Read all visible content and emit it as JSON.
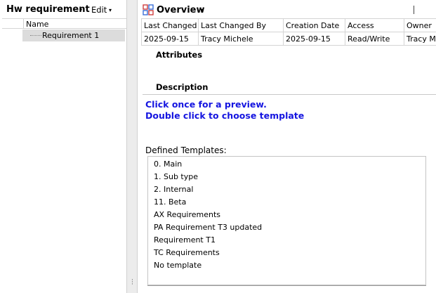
{
  "left_panel": {
    "title": "Hw requirement",
    "title_caret": "▾",
    "edit_label": "Edit",
    "edit_caret": "▾",
    "tree_column": "Name",
    "tree_items": [
      "Requirement 1"
    ]
  },
  "overview": {
    "title": "Overview",
    "caret": "▾",
    "icon": "overview-grid-icon",
    "icon_colors": [
      "#d04040",
      "#3a6fd8",
      "#d04040",
      "#3a6fd8"
    ]
  },
  "properties": {
    "headers": [
      "Last Changed",
      "Last Changed By",
      "Creation Date",
      "Access",
      "Owner"
    ],
    "row": [
      "2025-09-15",
      "Tracy Michele",
      "2025-09-15",
      "Read/Write",
      "Tracy Mic"
    ]
  },
  "sections": {
    "attributes": "Attributes",
    "description": "Description"
  },
  "preview": {
    "line1": "Click once for a preview.",
    "line2": "Double click to choose template",
    "color": "#1515e0"
  },
  "templates": {
    "label": "Defined Templates:",
    "items": [
      "0. Main",
      "1. Sub type",
      "2. Internal",
      "11. Beta",
      "AX Requirements",
      "PA Requirement T3 updated",
      "Requirement T1",
      "TC Requirements",
      "No template"
    ]
  }
}
